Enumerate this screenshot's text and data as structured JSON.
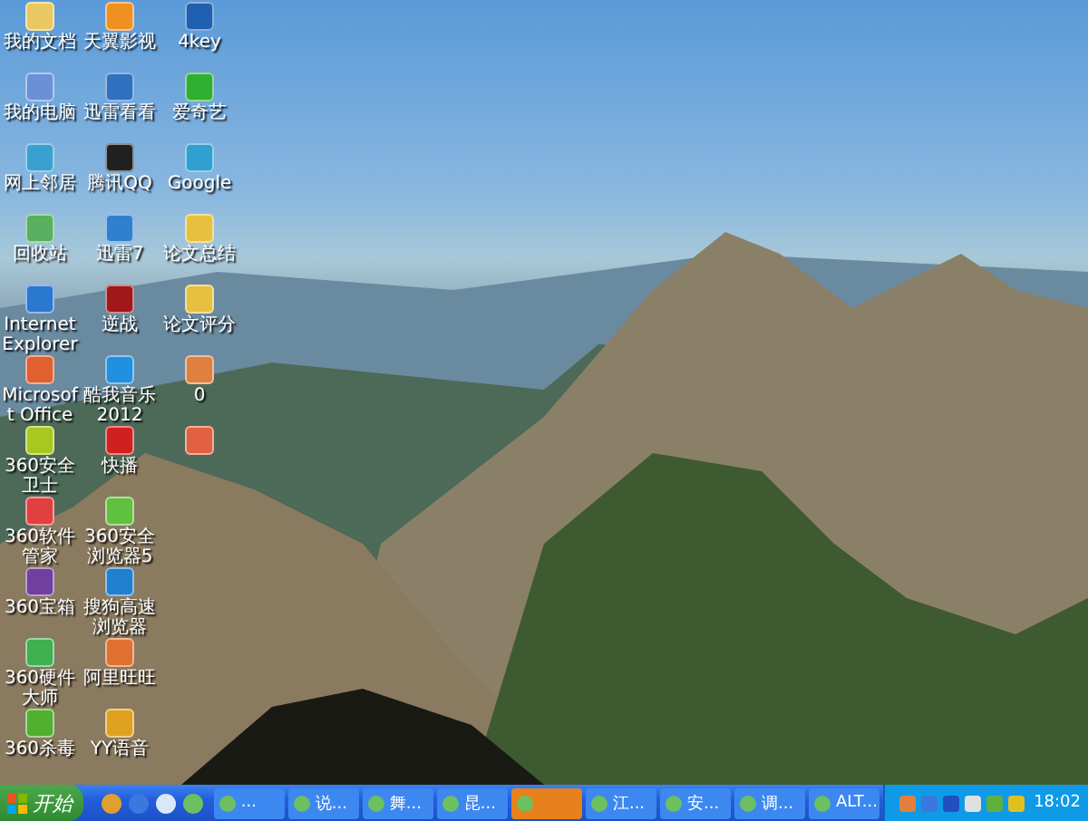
{
  "desktop_icons": [
    {
      "label": "我的文档",
      "color": "#e8c860"
    },
    {
      "label": "我的电脑",
      "color": "#6a90d8"
    },
    {
      "label": "网上邻居",
      "color": "#3aa0d0"
    },
    {
      "label": "回收站",
      "color": "#58b060"
    },
    {
      "label": "Internet Explorer",
      "color": "#2a78d0"
    },
    {
      "label": "Microsoft Office",
      "color": "#e06030"
    },
    {
      "label": "360安全卫士",
      "color": "#a8c820"
    },
    {
      "label": "360软件管家",
      "color": "#e04040"
    },
    {
      "label": "360宝箱",
      "color": "#7040a0"
    },
    {
      "label": "360硬件大师",
      "color": "#40b050"
    },
    {
      "label": "360杀毒",
      "color": "#50b030"
    },
    {
      "label": "天翼影视",
      "color": "#f09020"
    },
    {
      "label": "迅雷看看",
      "color": "#3070c0"
    },
    {
      "label": "腾讯QQ",
      "color": "#202020"
    },
    {
      "label": "迅雷7",
      "color": "#3080d0"
    },
    {
      "label": "逆战",
      "color": "#a01818"
    },
    {
      "label": "酷我音乐2012",
      "color": "#2090e0"
    },
    {
      "label": "快播",
      "color": "#d02020"
    },
    {
      "label": "360安全浏览器5",
      "color": "#60c040"
    },
    {
      "label": "搜狗高速浏览器",
      "color": "#2080d0"
    },
    {
      "label": "阿里旺旺",
      "color": "#e07030"
    },
    {
      "label": "YY语音",
      "color": "#e0a020"
    },
    {
      "label": "4key",
      "color": "#2060b0"
    },
    {
      "label": "爱奇艺",
      "color": "#30b030"
    },
    {
      "label": "Google",
      "color": "#30a0d0"
    },
    {
      "label": "论文总结",
      "color": "#e8c040"
    },
    {
      "label": "论文评分",
      "color": "#e8c040"
    },
    {
      "label": "0",
      "color": "#e08040"
    },
    {
      "color": "#e06040"
    }
  ],
  "taskbar": {
    "start": "开始",
    "tasks": [
      {
        "label": "...",
        "selected": false
      },
      {
        "label": "说...",
        "selected": false
      },
      {
        "label": "舞...",
        "selected": false
      },
      {
        "label": "昆...",
        "selected": false
      },
      {
        "selected": true
      },
      {
        "label": "江...",
        "selected": false
      },
      {
        "label": "安...",
        "selected": false
      },
      {
        "label": "调...",
        "selected": false
      },
      {
        "label": "ALT...",
        "selected": false
      }
    ],
    "clock": "18:02"
  }
}
